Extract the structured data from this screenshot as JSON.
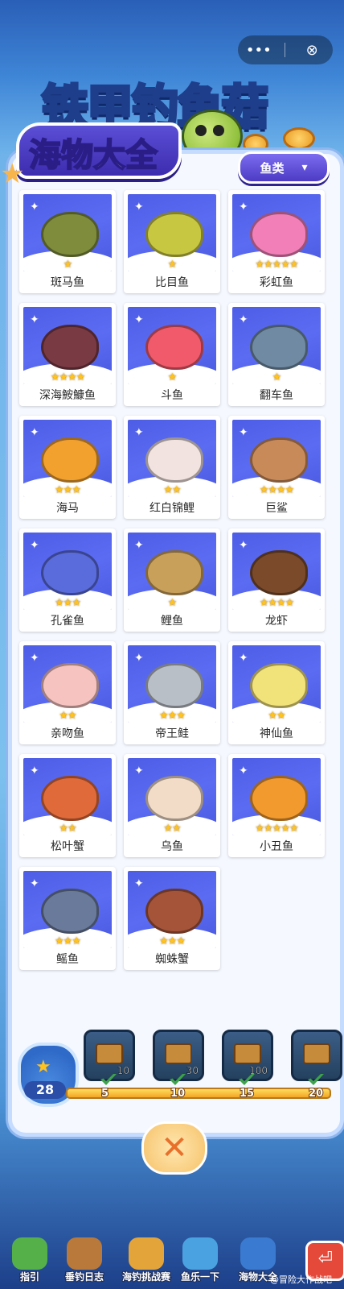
{
  "topbar": {
    "more_icon": "more-icon",
    "close_icon": "close-icon"
  },
  "game_title": "铁甲钓鱼菇",
  "page_title": "海物大全",
  "filter": {
    "selected": "鱼类"
  },
  "creatures": [
    {
      "name": "斑马鱼",
      "stars": "★",
      "color": "#7e8c3c"
    },
    {
      "name": "比目鱼",
      "stars": "★",
      "color": "#c8c742"
    },
    {
      "name": "彩虹鱼",
      "stars": "★★★★★",
      "color": "#f27fb8"
    },
    {
      "name": "深海鮟鱇鱼",
      "stars": "★★★★",
      "color": "#7a3a44"
    },
    {
      "name": "斗鱼",
      "stars": "★",
      "color": "#f05a6a"
    },
    {
      "name": "翻车鱼",
      "stars": "★",
      "color": "#6f8aa2"
    },
    {
      "name": "海马",
      "stars": "★★★",
      "color": "#f2a02e"
    },
    {
      "name": "红白锦鲤",
      "stars": "★★",
      "color": "#f2e3e0"
    },
    {
      "name": "巨鲨",
      "stars": "★★★★",
      "color": "#c98a5a"
    },
    {
      "name": "孔雀鱼",
      "stars": "★★★",
      "color": "#5a6bdc"
    },
    {
      "name": "鲤鱼",
      "stars": "★",
      "color": "#c9a05a"
    },
    {
      "name": "龙虾",
      "stars": "★★★★",
      "color": "#7a4a2a"
    },
    {
      "name": "亲吻鱼",
      "stars": "★★",
      "color": "#f6c3c0"
    },
    {
      "name": "帝王鲑",
      "stars": "★★★",
      "color": "#b9bfc6"
    },
    {
      "name": "神仙鱼",
      "stars": "★★",
      "color": "#f1e27a"
    },
    {
      "name": "松叶蟹",
      "stars": "★★",
      "color": "#e06a3a"
    },
    {
      "name": "乌鱼",
      "stars": "★★",
      "color": "#f2dcc8"
    },
    {
      "name": "小丑鱼",
      "stars": "★★★★★",
      "color": "#f29a2e"
    },
    {
      "name": "鳐鱼",
      "stars": "★★★",
      "color": "#6a7a9a"
    },
    {
      "name": "蜘蛛蟹",
      "stars": "★★★",
      "color": "#a5543a"
    }
  ],
  "collection": {
    "count": "28"
  },
  "rewards": [
    {
      "qty": "10",
      "milestone": "5"
    },
    {
      "qty": "30",
      "milestone": "10"
    },
    {
      "qty": "100",
      "milestone": "15"
    },
    {
      "qty": "",
      "milestone": "20"
    }
  ],
  "bottom_nav": [
    {
      "label": "指引",
      "color": "#56b04a"
    },
    {
      "label": "垂钓日志",
      "color": "#b8793a"
    },
    {
      "label": "海钓挑战赛",
      "color": "#e3a43a"
    },
    {
      "label": "鱼乐一下",
      "color": "#4aa3e0"
    },
    {
      "label": "海物大全",
      "color": "#3a7ad0"
    }
  ],
  "watermark": "@冒险大作战吧"
}
